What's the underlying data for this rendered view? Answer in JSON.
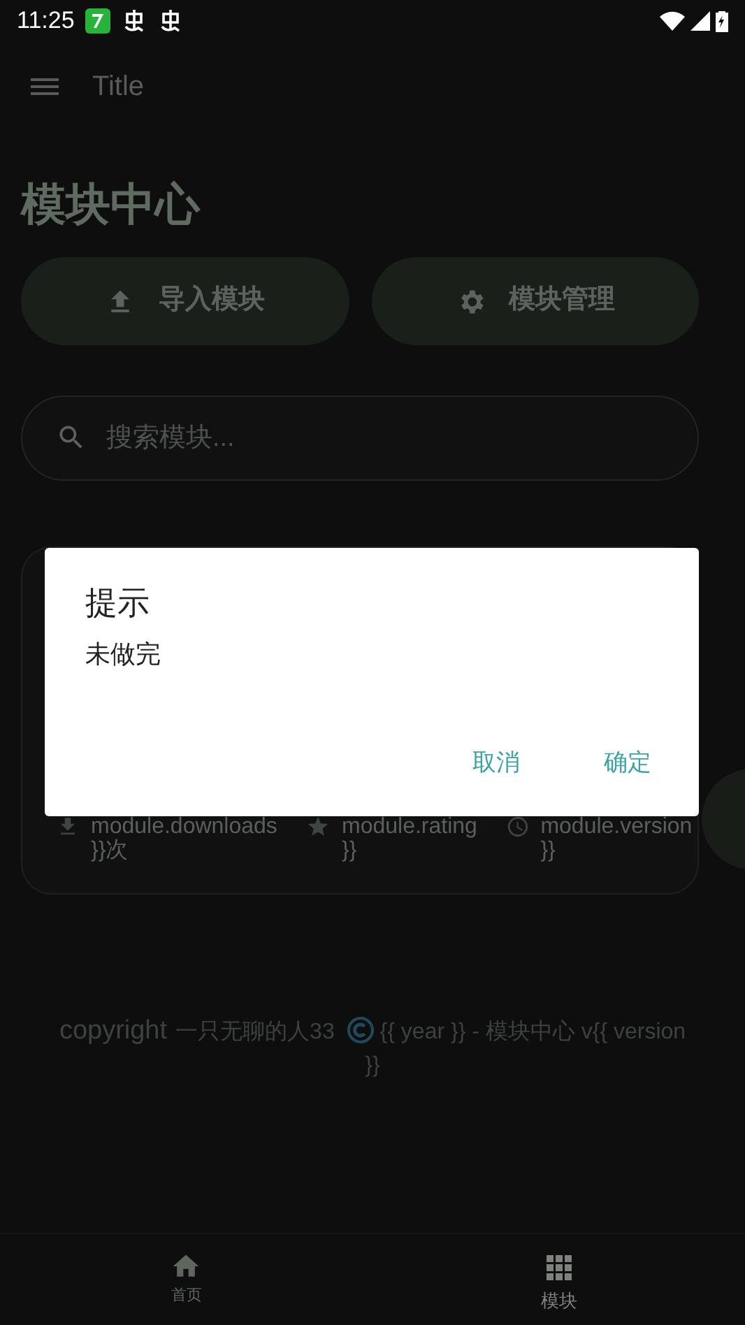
{
  "status_bar": {
    "time": "11:25"
  },
  "app_bar": {
    "title": "Title"
  },
  "page_title": "模块中心",
  "actions": [
    {
      "label": "导入模块"
    },
    {
      "label": "模块管理"
    }
  ],
  "search": {
    "placeholder": "搜索模块..."
  },
  "module_card": {
    "stats": [
      {
        "kind": "downloads",
        "text": "module.downloads }}次"
      },
      {
        "kind": "rating",
        "text": "module.rating }}"
      },
      {
        "kind": "version",
        "text": "module.version }}"
      }
    ]
  },
  "footer": {
    "label": "copyright",
    "author": "一只无聊的人33",
    "text": "{{ year }} - 模块中心 v{{ version }}"
  },
  "dialog": {
    "title": "提示",
    "message": "未做完",
    "buttons": [
      "取消",
      "确定"
    ]
  },
  "bottom_nav": [
    {
      "label": "首页",
      "selected": false
    },
    {
      "label": "模块",
      "selected": true
    }
  ]
}
